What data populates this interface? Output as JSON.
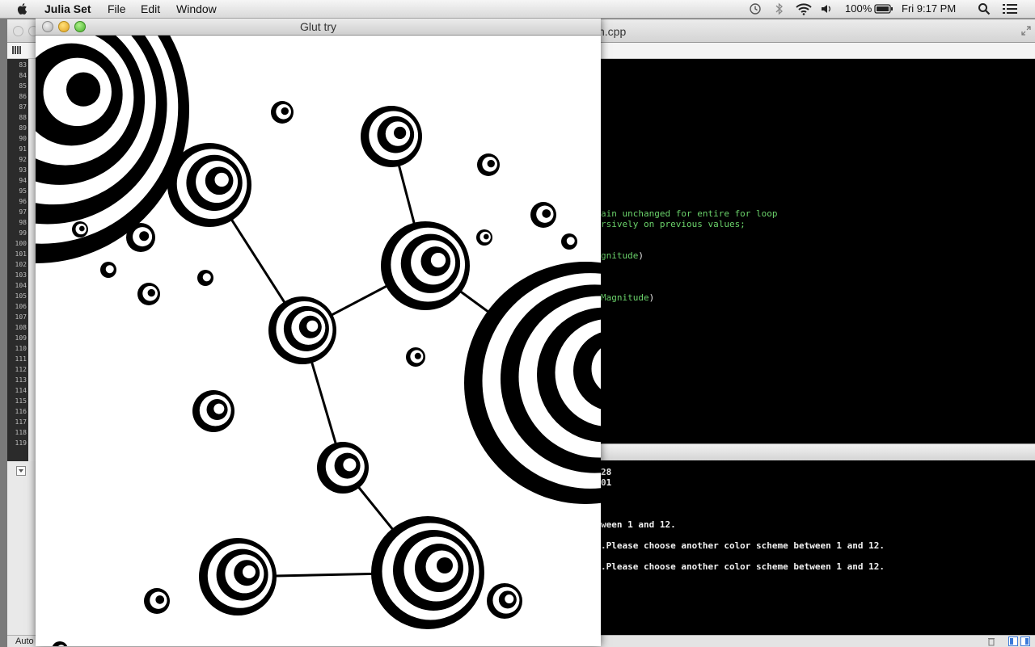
{
  "menubar": {
    "app_name": "Julia Set",
    "menus": [
      "File",
      "Edit",
      "Window"
    ],
    "battery": "100%",
    "clock": "Fri 9:17 PM"
  },
  "ide": {
    "file_title": "n.cpp",
    "line_numbers": [
      "83",
      "84",
      "85",
      "86",
      "87",
      "88",
      "89",
      "90",
      "91",
      "92",
      "93",
      "94",
      "95",
      "96",
      "97",
      "98",
      "99",
      "100",
      "101",
      "102",
      "103",
      "104",
      "105",
      "106",
      "107",
      "108",
      "109",
      "110",
      "111",
      "112",
      "113",
      "114",
      "115",
      "116",
      "117",
      "118",
      "119"
    ],
    "code_lines": [
      {
        "text": "ain unchanged for entire for loop"
      },
      {
        "text": "rsively on previous values;"
      },
      {
        "text": "gnitude",
        "close": ")"
      },
      {
        "text": "Magnitude",
        "close": ")"
      }
    ],
    "console_lines": [
      "28",
      "01",
      "ween 1 and 12.",
      ".Please choose another color scheme between 1 and 12.",
      ".Please choose another color scheme between 1 and 12."
    ],
    "status_text": "Auto"
  },
  "glut": {
    "title": "Glut try"
  },
  "colors": {
    "fractal_fill": "#000000",
    "fractal_bg": "#ffffff",
    "code_green": "#6bd36b",
    "editor_bg": "#000000"
  }
}
